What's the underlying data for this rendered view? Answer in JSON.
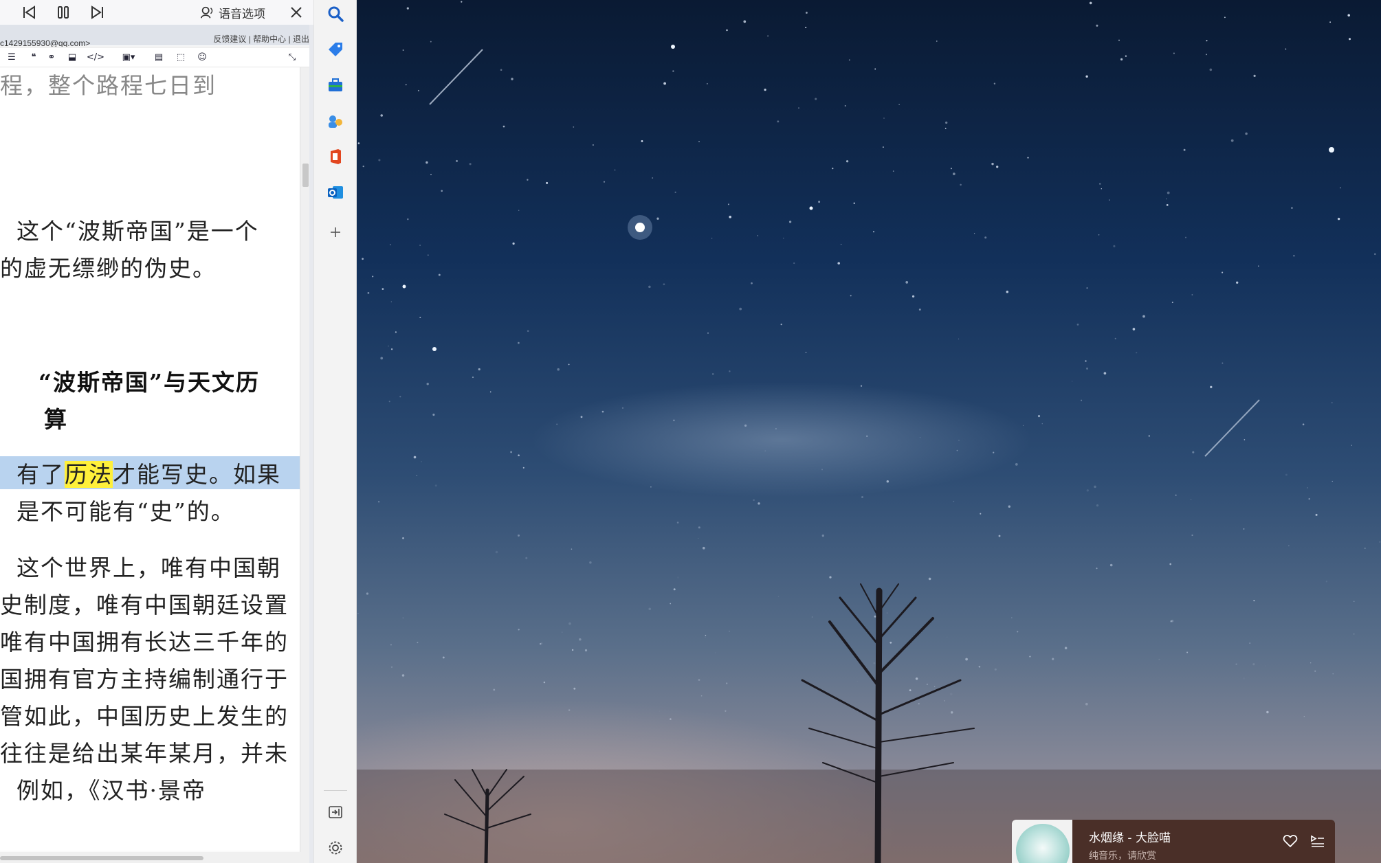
{
  "player": {
    "voice_options_label": "语音选项"
  },
  "web": {
    "account_text": "c1429155930@qq.com>",
    "links": [
      "反馈建议",
      "帮助中心",
      "退出"
    ]
  },
  "document": {
    "lines": [
      "程，整个路程七日到",
      "这个“波斯帝国”是一个",
      "的虚无缥缈的伪史。",
      "“波斯帝国”与天文历",
      "算",
      "是不可能有“史”的。",
      "这个世界上，唯有中国朝",
      "史制度，唯有中国朝廷设置",
      "唯有中国拥有长达三千年的",
      "国拥有官方主持编制通行于",
      "管如此，中国历史上发生的",
      "往往是给出某年某月，并未",
      "例如，《汉书·景帝"
    ],
    "highlight_line": {
      "before": "有了",
      "highlight": "历法",
      "after": "才能写史。如果"
    }
  },
  "music": {
    "title": "水烟缘 - 大脸喵",
    "subtitle": "纯音乐，请欣赏"
  },
  "colors": {
    "selection": "#b9d3ef",
    "highlight": "#fff03a",
    "music_bg": "#4a2f28"
  }
}
